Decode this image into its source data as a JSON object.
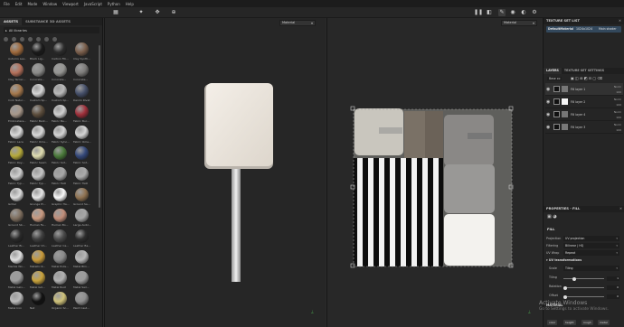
{
  "menu": [
    "File",
    "Edit",
    "Mode",
    "Window",
    "Viewport",
    "JavaScript",
    "Python",
    "Help"
  ],
  "shelf": {
    "tabs": [
      "ASSETS",
      "SUBSTANCE 3D ASSETS"
    ],
    "library_label": "All libraries",
    "materials": [
      {
        "label": "Autumn Lea...",
        "color": "#a06a3c"
      },
      {
        "label": "Black Lig...",
        "color": "#1a1a1a"
      },
      {
        "label": "Carbon Fib...",
        "color": "#2b2b2b"
      },
      {
        "label": "Clay Synth...",
        "color": "#7a5e4b"
      },
      {
        "label": "Clay Terrac...",
        "color": "#b4705a"
      },
      {
        "label": "Concrete...",
        "color": "#8a8a88"
      },
      {
        "label": "Concrete...",
        "color": "#959592"
      },
      {
        "label": "Concrete...",
        "color": "#7d7c7a"
      },
      {
        "label": "Cork Natur...",
        "color": "#a5784c"
      },
      {
        "label": "Custom Sp...",
        "color": "#d6d6d6"
      },
      {
        "label": "Custom Sp...",
        "color": "#b9b9b9"
      },
      {
        "label": "Denim Rivet",
        "color": "#46506a"
      },
      {
        "label": "Embroidere...",
        "color": "#a8988a"
      },
      {
        "label": "Fabric Bark...",
        "color": "#5c4d3c"
      },
      {
        "label": "Fabric Ba...",
        "color": "#d0d0d0"
      },
      {
        "label": "Fabric Bur...",
        "color": "#9f2f3a"
      },
      {
        "label": "Fabric Lace",
        "color": "#d9d9d9"
      },
      {
        "label": "Fabric Ome...",
        "color": "#d8d8d8"
      },
      {
        "label": "Fabric Sylvi...",
        "color": "#d5d5d5"
      },
      {
        "label": "Fabric Ome...",
        "color": "#d4d4d4"
      },
      {
        "label": "Fabric Ray...",
        "color": "#b5a93a"
      },
      {
        "label": "Fabric Seam",
        "color": "#e0ddb0"
      },
      {
        "label": "Fabric Sof...",
        "color": "#4a7a3a"
      },
      {
        "label": "Fabric Sof...",
        "color": "#34487a"
      },
      {
        "label": "Fabric Typ...",
        "color": "#cfcfcf"
      },
      {
        "label": "Fabric Typ...",
        "color": "#c6c6c6"
      },
      {
        "label": "Fabric Twill",
        "color": "#a7a7a7"
      },
      {
        "label": "Fabric Twill",
        "color": "#ababab"
      },
      {
        "label": "Grillel",
        "color": "#dcdcdc"
      },
      {
        "label": "Grunge Pl...",
        "color": "#e6e6e6"
      },
      {
        "label": "Graphic Ha...",
        "color": "#fafafa"
      },
      {
        "label": "Ground Sa...",
        "color": "#8f7251"
      },
      {
        "label": "Ground Sb...",
        "color": "#7f6f5f"
      },
      {
        "label": "Human Fa...",
        "color": "#c99a80"
      },
      {
        "label": "Human Bo...",
        "color": "#c28e7a"
      },
      {
        "label": "Large Avibl...",
        "color": "#a7a7a7"
      },
      {
        "label": "Leather Bi...",
        "color": "#2a2a2a"
      },
      {
        "label": "Leather Ch...",
        "color": "#3f3f3f"
      },
      {
        "label": "Leather Ca...",
        "color": "#4a4a4a"
      },
      {
        "label": "Leather Ba...",
        "color": "#2d2d2d"
      },
      {
        "label": "Marble Wo...",
        "color": "#e0e0e0"
      },
      {
        "label": "Metallic R...",
        "color": "#c89a3a"
      },
      {
        "label": "Metal Polis...",
        "color": "#8a8a8a"
      },
      {
        "label": "Metal Blin...",
        "color": "#b7b7b7"
      },
      {
        "label": "Metal Galv...",
        "color": "#9c9c9c"
      },
      {
        "label": "Metal Gol...",
        "color": "#c8a23c"
      },
      {
        "label": "Metal Rust",
        "color": "#b0b0b0"
      },
      {
        "label": "Metal Sail...",
        "color": "#9b9b9b"
      },
      {
        "label": "Metal Iron",
        "color": "#bbbbbb"
      },
      {
        "label": "Nat",
        "color": "#111111"
      },
      {
        "label": "Organic Sc...",
        "color": "#cfc27a"
      },
      {
        "label": "Paint Cast...",
        "color": "#8f8f8f"
      }
    ]
  },
  "viewport3d": {
    "mode": "Material"
  },
  "viewport2d": {
    "mode": "Material"
  },
  "texture_set_list": {
    "title": "TEXTURE SET LIST",
    "name": "DefaultMaterial",
    "resolution": "1024x1024",
    "shader": "Main shader"
  },
  "layers": {
    "tabs": [
      "LAYERS",
      "TEXTURE SET SETTINGS"
    ],
    "base_dropdown": "Base co",
    "items": [
      {
        "name": "Fill layer 1",
        "blend": "Norm",
        "opacity": "100"
      },
      {
        "name": "Fill layer 2",
        "blend": "Norm",
        "opacity": "100"
      },
      {
        "name": "Fill layer 4",
        "blend": "Norm",
        "opacity": "100"
      },
      {
        "name": "Fill layer 3",
        "blend": "Norm",
        "opacity": "100"
      }
    ]
  },
  "properties": {
    "title": "PROPERTIES - FILL",
    "section": "FILL",
    "projection_label": "Projection",
    "projection_value": "UV projection",
    "filtering_label": "Filtering",
    "filtering_value": "Bilinear | HQ",
    "uvwrap_label": "UV Wrap",
    "uvwrap_value": "Repeat",
    "uv_section": "UV transformations",
    "scale_label": "Scale",
    "scale_value": "Tiling",
    "tiling_label": "Tiling",
    "tiling_value": "1",
    "rotation_label": "Rotation",
    "rotation_value": "0",
    "offset_label": "Offset",
    "offset_value": "0",
    "material_label": "MATERIAL",
    "channels": [
      "color",
      "height",
      "rough",
      "metal"
    ]
  },
  "watermark": {
    "line1": "Activate Windows",
    "line2": "Go to Settings to activate Windows."
  }
}
